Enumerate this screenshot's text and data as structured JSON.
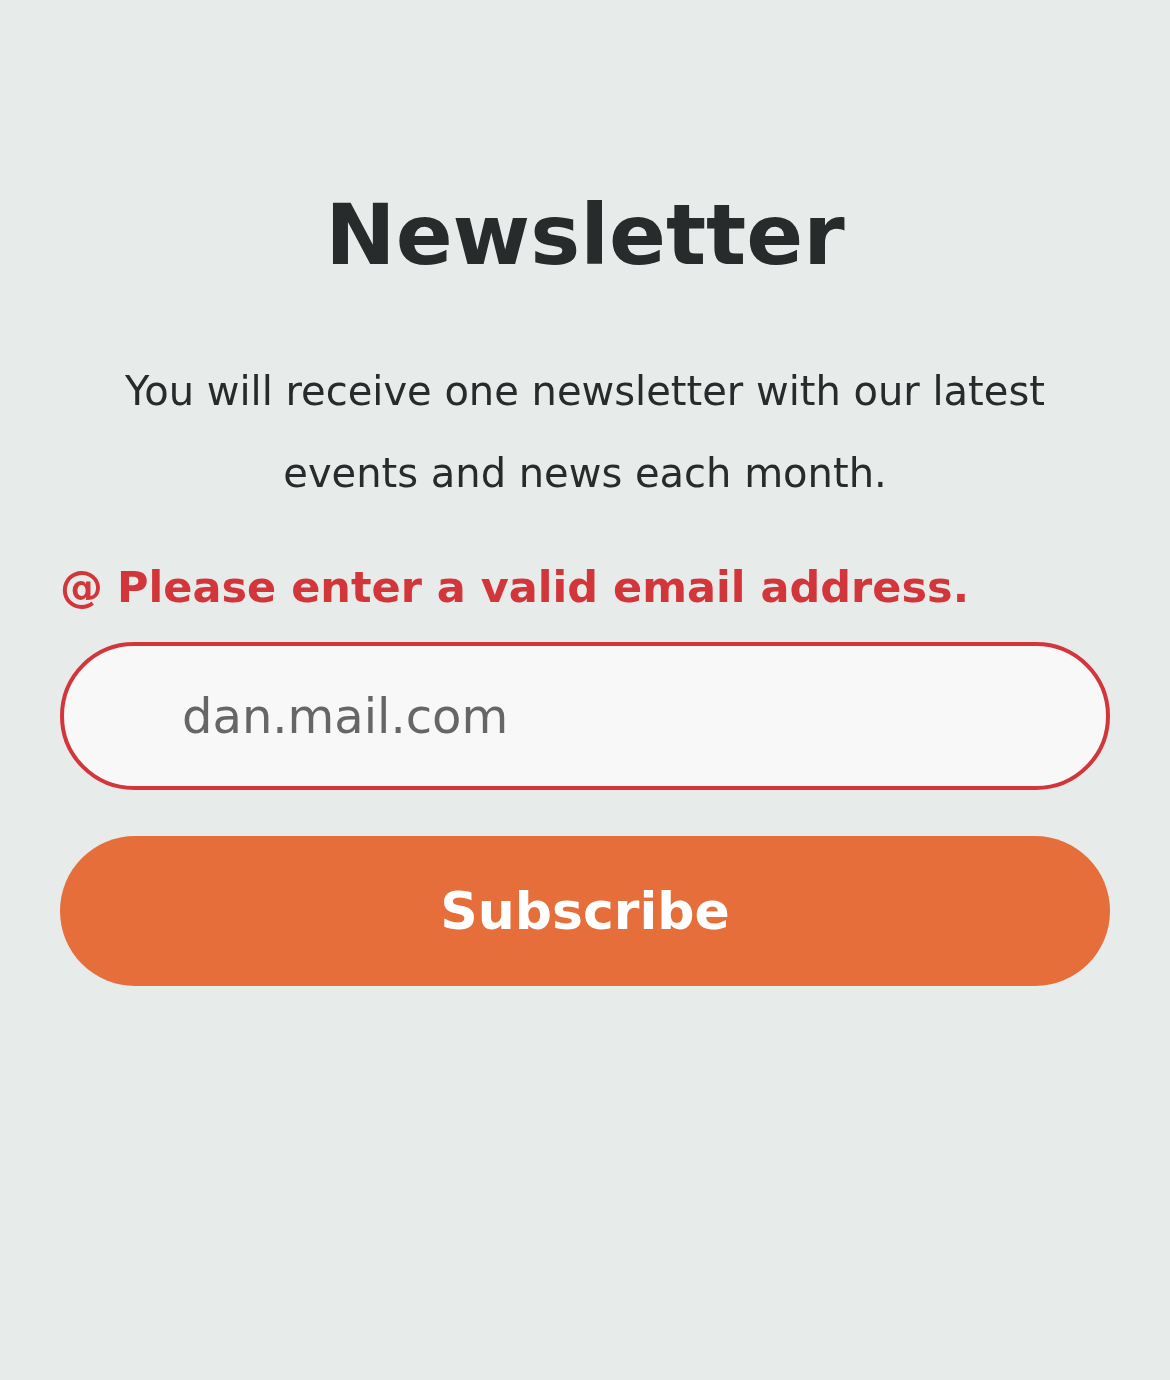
{
  "title": "Newsletter",
  "description": "You will receive one newsletter with our latest events and news each month.",
  "error": {
    "icon": "@",
    "message": "Please enter a valid email address."
  },
  "email_field": {
    "value": "dan.mail.com",
    "invalid": true
  },
  "button": {
    "label": "Subscribe"
  }
}
